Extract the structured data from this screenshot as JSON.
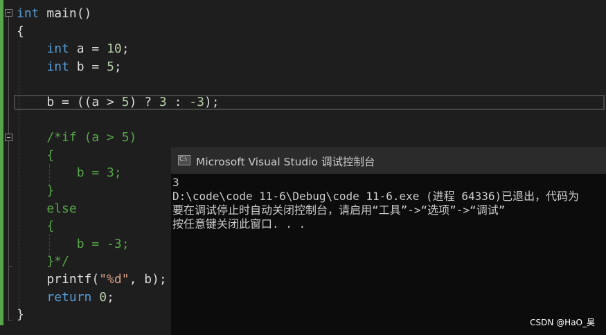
{
  "code_lines": [
    {
      "parts": [
        {
          "t": "int",
          "c": "kw"
        },
        {
          "t": " main()",
          "c": "fn"
        }
      ]
    },
    {
      "parts": [
        {
          "t": "{",
          "c": "op"
        }
      ]
    },
    {
      "parts": [
        {
          "t": "    "
        },
        {
          "t": "int",
          "c": "kw"
        },
        {
          "t": " a = ",
          "c": "id"
        },
        {
          "t": "10",
          "c": "num"
        },
        {
          "t": ";",
          "c": "op"
        }
      ]
    },
    {
      "parts": [
        {
          "t": "    "
        },
        {
          "t": "int",
          "c": "kw"
        },
        {
          "t": " b = ",
          "c": "id"
        },
        {
          "t": "5",
          "c": "num"
        },
        {
          "t": ";",
          "c": "op"
        }
      ]
    },
    {
      "parts": [
        {
          "t": ""
        }
      ]
    },
    {
      "parts": [
        {
          "t": "    b = ((a > ",
          "c": "id"
        },
        {
          "t": "5",
          "c": "num"
        },
        {
          "t": ") ? ",
          "c": "id"
        },
        {
          "t": "3",
          "c": "num"
        },
        {
          "t": " : ",
          "c": "id"
        },
        {
          "t": "-3",
          "c": "num"
        },
        {
          "t": ");",
          "c": "op"
        }
      ]
    },
    {
      "parts": [
        {
          "t": ""
        }
      ]
    },
    {
      "parts": [
        {
          "t": "    /*if (a > 5)",
          "c": "cm"
        }
      ]
    },
    {
      "parts": [
        {
          "t": "    {",
          "c": "cm"
        }
      ]
    },
    {
      "parts": [
        {
          "t": "        b = 3;",
          "c": "cm"
        }
      ]
    },
    {
      "parts": [
        {
          "t": "    }",
          "c": "cm"
        }
      ]
    },
    {
      "parts": [
        {
          "t": "    else",
          "c": "cm"
        }
      ]
    },
    {
      "parts": [
        {
          "t": "    {",
          "c": "cm"
        }
      ]
    },
    {
      "parts": [
        {
          "t": "        b = -3;",
          "c": "cm"
        }
      ]
    },
    {
      "parts": [
        {
          "t": "    }*/",
          "c": "cm"
        }
      ]
    },
    {
      "parts": [
        {
          "t": "    printf(",
          "c": "fn"
        },
        {
          "t": "\"%d\"",
          "c": "str"
        },
        {
          "t": ", b);",
          "c": "id"
        }
      ]
    },
    {
      "parts": [
        {
          "t": "    "
        },
        {
          "t": "return",
          "c": "kw"
        },
        {
          "t": " ",
          "c": "id"
        },
        {
          "t": "0",
          "c": "num"
        },
        {
          "t": ";",
          "c": "op"
        }
      ]
    },
    {
      "parts": [
        {
          "t": "}",
          "c": "op"
        }
      ]
    }
  ],
  "console": {
    "icon_label": "C:\\",
    "title": "Microsoft Visual Studio 调试控制台",
    "output_lines": [
      "3",
      "D:\\code\\code 11-6\\Debug\\code 11-6.exe (进程 64336)已退出，代码为",
      "要在调试停止时自动关闭控制台，请启用“工具”->“选项”->“调试”",
      "按任意键关闭此窗口. . ."
    ]
  },
  "watermark": "CSDN @HaO_昊",
  "colors": {
    "keyword": "#569cd6",
    "number": "#b5cea8",
    "string": "#d69d85",
    "comment": "#57a64a",
    "text": "#dcdcdc",
    "editor_bg": "#1e1e1e",
    "console_bg": "#0c0c0c"
  }
}
